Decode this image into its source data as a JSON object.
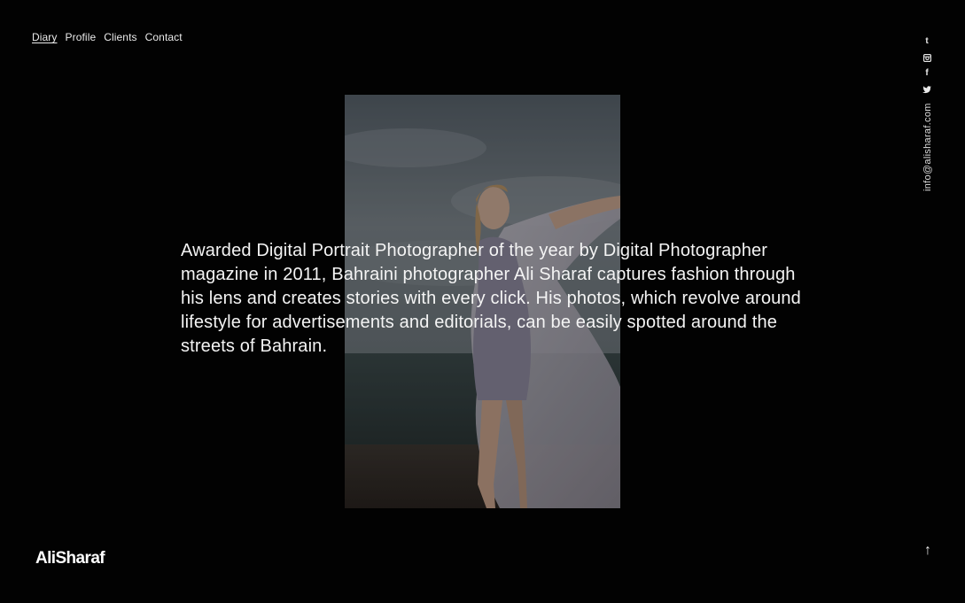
{
  "nav": {
    "items": [
      {
        "label": "Diary",
        "active": true
      },
      {
        "label": "Profile",
        "active": false
      },
      {
        "label": "Clients",
        "active": false
      },
      {
        "label": "Contact",
        "active": false
      }
    ]
  },
  "intro": {
    "text": "Awarded Digital Portrait Photographer of the year by Digital Photographer magazine in 2011, Bahraini photographer Ali Sharaf captures fashion through his lens and creates stories with every click. His photos, which revolve around lifestyle for advertisements and editorials, can be easily spotted around the streets of Bahrain."
  },
  "social": {
    "icons": [
      "tumblr-icon",
      "instagram-icon",
      "facebook-icon",
      "twitter-icon"
    ],
    "tumblr_glyph": "t",
    "facebook_glyph": "f"
  },
  "contact": {
    "email": "info@alisharaf.com"
  },
  "logo": {
    "text": "AliSharaf"
  },
  "to_top": {
    "glyph": "↑"
  },
  "colors": {
    "background": "#020202",
    "text": "#f4f4f4"
  }
}
